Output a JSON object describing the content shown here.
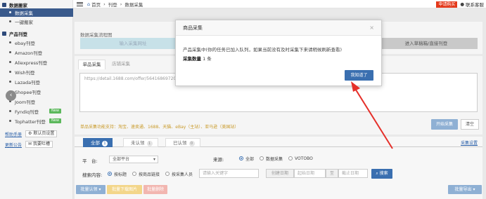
{
  "sidebar": {
    "sections": [
      {
        "label": "数据搬家",
        "items": [
          {
            "label": "数据采集",
            "active": true
          },
          {
            "label": "一键搬家"
          }
        ]
      },
      {
        "label": "产品刊登",
        "items": [
          {
            "label": "ebay刊登"
          },
          {
            "label": "Amazon刊登"
          },
          {
            "label": "Aliexpress刊登"
          },
          {
            "label": "Wish刊登"
          },
          {
            "label": "Lazada刊登"
          },
          {
            "label": "Shopee刊登"
          },
          {
            "label": "Joom刊登"
          },
          {
            "label": "Fyndiq刊登",
            "badge": "New"
          },
          {
            "label": "Tophatter刊登",
            "badge": "New"
          }
        ]
      }
    ],
    "footer": {
      "help": "帮助手册",
      "default_settings": "默认页设置",
      "updates": "更新公告",
      "feedback": "我要吐槽"
    }
  },
  "topbar": {
    "home": "首页",
    "crumb1": "刊登",
    "crumb2": "数据采集",
    "buy": "申请购买",
    "service": "联系客服"
  },
  "flow": {
    "title": "数据采集流程图",
    "step1": "输入采集网址",
    "step4": "进入草稿箱/直接刊登"
  },
  "collect_tabs": [
    "单品采集",
    "店铺采集"
  ],
  "url_text": "https://detail.1688.com/offer/564168697202",
  "support_tip": "单品采集功能支持：淘宝、速卖通、1688、天猫、eBay（主站）、亚马逊（美国站）",
  "buttons": {
    "start": "开始采集",
    "clear": "清空"
  },
  "filter_tabs": [
    {
      "label": "全部",
      "count": "1"
    },
    {
      "label": "未认领",
      "count": "1"
    },
    {
      "label": "已认领",
      "count": "0"
    }
  ],
  "settings_link": "采集设置",
  "filters": {
    "platform_label": "平　台:",
    "platform_value": "全部平台",
    "source_label": "来源:",
    "source_options": [
      "全部",
      "数据采集",
      "VOTOBO"
    ],
    "search_label": "搜索内容:",
    "search_options": [
      "按标题",
      "按商品链接",
      "按采集人员"
    ],
    "search_placeholder": "请输入关键字",
    "date_label": "创建日期",
    "date_start": "起始日期",
    "date_to": "至",
    "date_end": "截止日期",
    "search_button": "搜索"
  },
  "bulk": {
    "claim": "批量认领",
    "download": "批量下载图片",
    "delete": "批量删除",
    "export": "批量导出"
  },
  "modal": {
    "title": "商品采集",
    "message": "产品采集中(你的任务已加入队列，如果当前没有及时采集下来请稍候刷新查看)",
    "count_label": "采集数量",
    "count_value": "1",
    "count_unit": "条",
    "ok_button": "我知道了"
  },
  "colors": {
    "primary": "#3a6fb0",
    "sidebar_active": "#3a5a8c",
    "buy": "#e4391b",
    "arrow": "#e5302a",
    "new_badge": "#5cb85c"
  }
}
